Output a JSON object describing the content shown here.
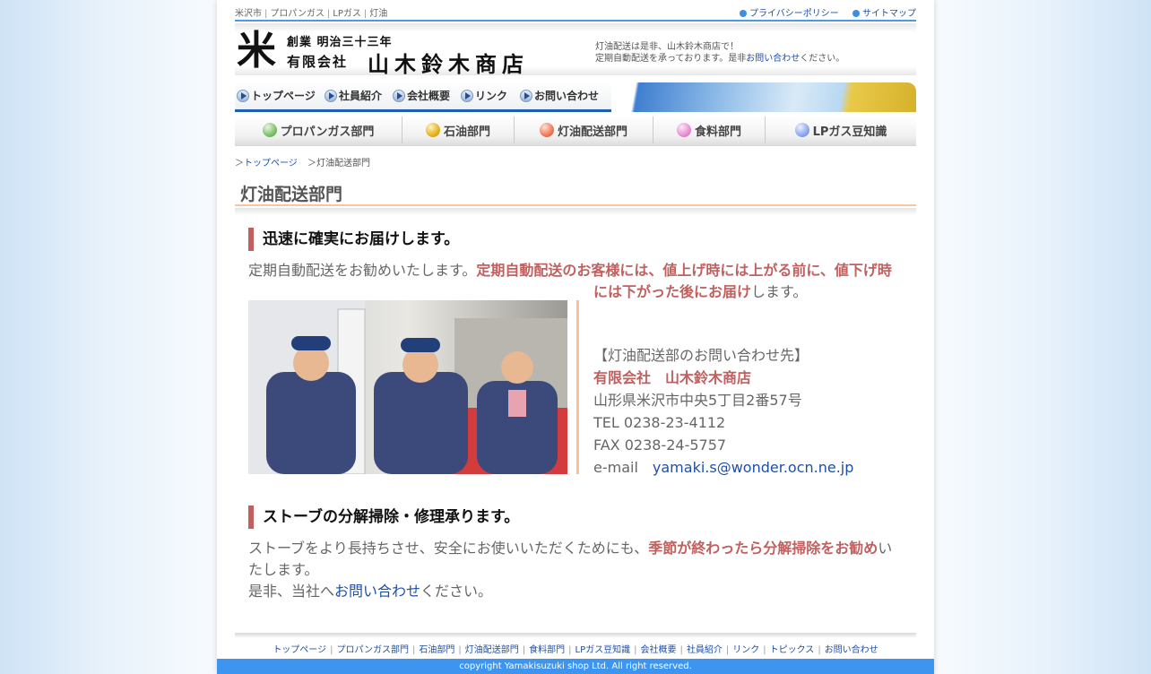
{
  "topbar": {
    "tags": [
      "米沢市",
      "プロパンガス",
      "LPガス",
      "灯油"
    ],
    "links": [
      {
        "label": "プライバシーポリシー"
      },
      {
        "label": "サイトマップ"
      }
    ]
  },
  "logo": {
    "mark": "米",
    "established": "創業 明治三十三年",
    "company_type": "有限会社",
    "company_name": "山木鈴木商店"
  },
  "tagline": {
    "line1": "灯油配送は是非、山木鈴木商店で！",
    "line2_before": "定期自動配送を承っております。是非",
    "line2_link": "お問い合わせ",
    "line2_after": "ください。"
  },
  "nav": {
    "items": [
      "トップページ",
      "社員紹介",
      "会社概要",
      "リンク",
      "お問い合わせ"
    ]
  },
  "departments": {
    "items": [
      {
        "label": "プロパンガス部門",
        "color": "#7fc06b"
      },
      {
        "label": "石油部門",
        "color": "#e6b21e"
      },
      {
        "label": "灯油配送部門",
        "color": "#f07a57"
      },
      {
        "label": "食料部門",
        "color": "#e88ed2"
      },
      {
        "label": "LPガス豆知識",
        "color": "#8ea8ee"
      }
    ]
  },
  "breadcrumb": {
    "home": "トップページ",
    "current": "灯油配送部門",
    "separator": "＞"
  },
  "page_title": "灯油配送部門",
  "section1": {
    "heading": "迅速に確実にお届けします。",
    "text_before": "定期自動配送をお勧めいたします。",
    "highlight_line1": "定期自動配送のお客様には、値上げ時には上がる前に、値下げ時",
    "highlight_line2": "には下がった後にお届け",
    "text_after": "します。",
    "contact": {
      "heading": "【灯油配送部のお問い合わせ先】",
      "company": "有限会社　山木鈴木商店",
      "address": "山形県米沢市中央5丁目2番57号",
      "tel": "TEL 0238-23-4112",
      "fax": "FAX 0238-24-5757",
      "email_label": "e-mail",
      "email": "yamaki.s@wonder.ocn.ne.jp"
    }
  },
  "section2": {
    "heading": "ストーブの分解掃除・修理承ります。",
    "text_before": "ストーブをより長持ちさせ、安全にお使いいただくためにも、",
    "highlight": "季節が終わったら分解掃除をお勧め",
    "text_after_1": "い",
    "text_after_2": "たします。",
    "line2_before": "是非、当社へ",
    "line2_link": "お問い合わせ",
    "line2_after": "ください。"
  },
  "footer": {
    "links": [
      "トップページ",
      "プロパンガス部門",
      "石油部門",
      "灯油配送部門",
      "食料部門",
      "LPガス豆知識",
      "会社概要",
      "社員紹介",
      "リンク",
      "トピックス",
      "お問い合わせ"
    ],
    "copyright": "copyright Yamakisuzuki shop Ltd. All right reserved."
  }
}
